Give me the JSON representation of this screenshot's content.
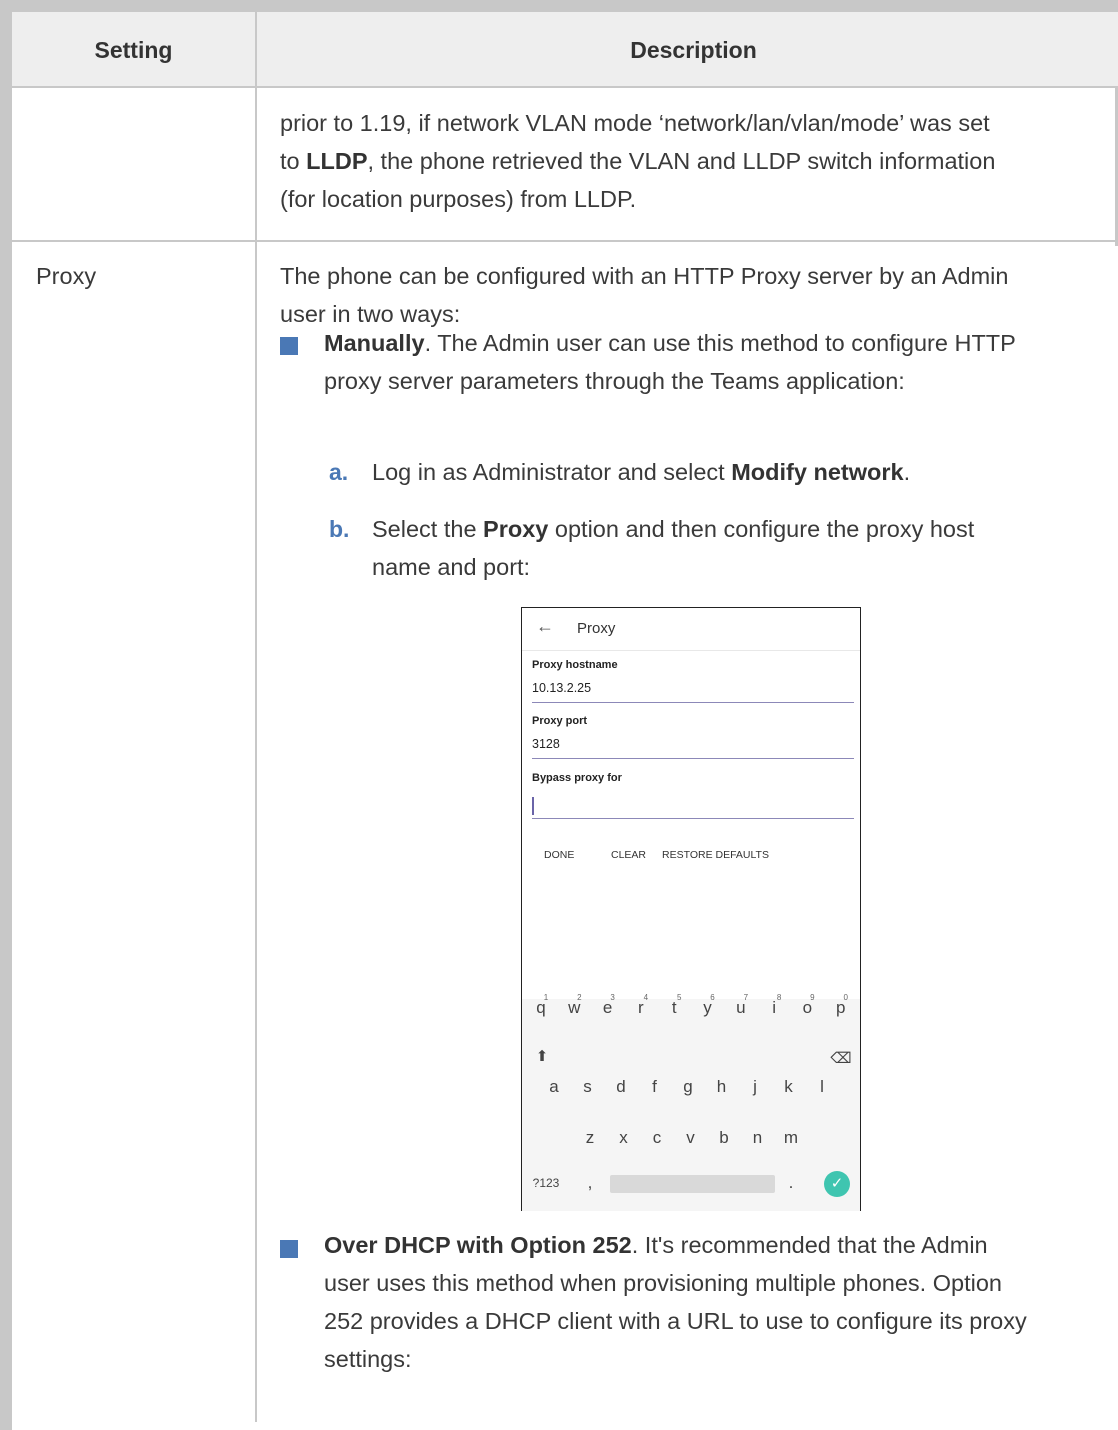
{
  "header": {
    "setting": "Setting",
    "description": "Description"
  },
  "row1": {
    "line1": "prior to 1.19, if network VLAN mode ‘network/lan/vlan/mode’ was set",
    "line2_pre": "to ",
    "line2_bold": "LLDP",
    "line2_post": ", the phone retrieved the VLAN and LLDP switch information",
    "line3": "(for location purposes) from LLDP."
  },
  "row2": {
    "setting": "Proxy",
    "intro1": "The phone can be configured with an HTTP Proxy server by an Admin",
    "intro2": "user in two ways:",
    "bullet1": {
      "bold": "Manually",
      "line1_rest": ". The Admin user can use this method to configure HTTP",
      "line2": "proxy server parameters through the Teams application:"
    },
    "step_a": {
      "letter": "a.",
      "text": "Log in as Administrator and select ",
      "bold": "Modify network",
      "post": "."
    },
    "step_b": {
      "letter": "b.",
      "pre": "Select the ",
      "bold": "Proxy",
      "post": " option and then configure the proxy host",
      "line2": "name and port:"
    },
    "bullet2": {
      "bold": "Over DHCP with Option 252",
      "line1_rest": ". It's recommended that the Admin",
      "line2": "user uses this method when provisioning multiple phones. Option",
      "line3": "252 provides a DHCP client with a URL to use to configure its proxy",
      "line4": "settings:"
    }
  },
  "phone": {
    "back_icon": "←",
    "title": "Proxy",
    "hostname_label": "Proxy hostname",
    "hostname_value": "10.13.2.25",
    "port_label": "Proxy port",
    "port_value": "3128",
    "bypass_label": "Bypass proxy for",
    "bypass_value": "",
    "done": "DONE",
    "clear": "CLEAR",
    "restore": "RESTORE DEFAULTS",
    "keyboard": {
      "row1": [
        "q",
        "w",
        "e",
        "r",
        "t",
        "y",
        "u",
        "i",
        "o",
        "p"
      ],
      "row1_nums": [
        "1",
        "2",
        "3",
        "4",
        "5",
        "6",
        "7",
        "8",
        "9",
        "0"
      ],
      "row2": [
        "a",
        "s",
        "d",
        "f",
        "g",
        "h",
        "j",
        "k",
        "l"
      ],
      "row3": [
        "z",
        "x",
        "c",
        "v",
        "b",
        "n",
        "m"
      ],
      "shift": "⬆",
      "backspace": "⌫",
      "symbols": "?123",
      "comma": ",",
      "period": ".",
      "enter": "✓"
    }
  },
  "colors": {
    "accent": "#4a78b5",
    "border": "#c8c8c8",
    "header_bg": "#eeeeee",
    "confirm": "#3fc5b0"
  }
}
